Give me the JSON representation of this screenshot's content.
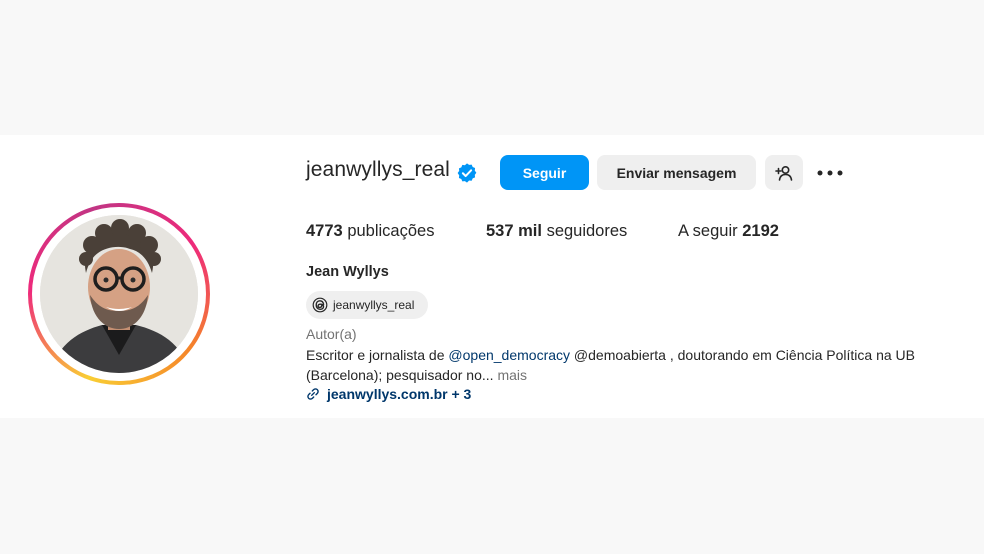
{
  "profile": {
    "username": "jeanwyllys_real",
    "verified": true,
    "verified_icon": "verified-badge-icon",
    "follow_label": "Seguir",
    "message_label": "Enviar mensagem",
    "add_user_icon": "person-add-icon",
    "more_icon": "more-options-icon",
    "stats": {
      "posts_count": "4773",
      "posts_label": "publicações",
      "followers_count": "537 mil",
      "followers_label": "seguidores",
      "following_label": "A seguir",
      "following_count": "2192"
    },
    "full_name": "Jean Wyllys",
    "threads_handle": "jeanwyllys_real",
    "category": "Autor(a)",
    "bio": {
      "part1": "Escritor e jornalista de ",
      "mention1": "@open_democracy",
      "part2": " @demoabierta , doutorando em Ciência Política na UB (Barcelona); pesquisador no...",
      "more": " mais"
    },
    "link_text": "jeanwyllys.com.br + 3"
  },
  "colors": {
    "accent": "#0095f6",
    "link": "#00376b",
    "muted": "#737373",
    "button_bg": "#efefef"
  }
}
